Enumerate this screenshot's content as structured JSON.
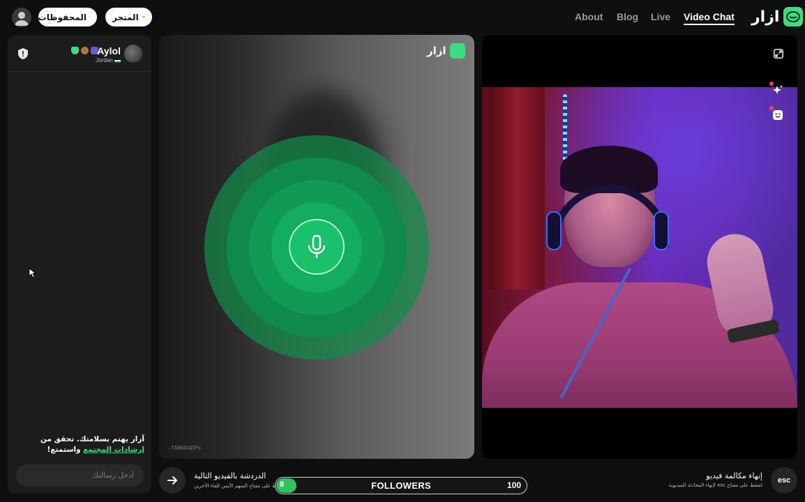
{
  "header": {
    "brand": "ازار",
    "nav": [
      {
        "label": "About"
      },
      {
        "label": "Blog"
      },
      {
        "label": "Live"
      },
      {
        "label": "Video Chat",
        "active": true
      }
    ],
    "store_label": "المتجر",
    "saved_label": "المحفوظات",
    "icons": {
      "store": "diamond-icon",
      "saved": "clock-icon",
      "profile": "user-icon"
    }
  },
  "chat": {
    "user": {
      "name": "Aylol",
      "country": "Jordan"
    },
    "safety_text": "آزار يهتم بسلامتك. تحقق من",
    "safety_link": "إرشادات المجتمع",
    "safety_end": "واستمتع!",
    "input_placeholder": "أدخل رسالتك"
  },
  "remote": {
    "watermark": "ازار",
    "session_id": "-fAWU04DPs"
  },
  "bottom": {
    "next_title": "الدردشة بالفيديو التالية",
    "next_sub": "اضغط على مفتاح السهم الأيمن للقاء الآخرين",
    "followers": {
      "label": "FOLLOWERS",
      "current": "8",
      "goal": "100",
      "progress": 0.08
    },
    "end_title": "إنهاء مكالمة فيديو",
    "end_sub": "اضغط على مفتاح esc لإنهاء المحادثة الفيديوية",
    "esc_label": "esc"
  },
  "colors": {
    "accent": "#3ddc84",
    "progress": "#33c15b",
    "panel": "#1c1c1c"
  }
}
